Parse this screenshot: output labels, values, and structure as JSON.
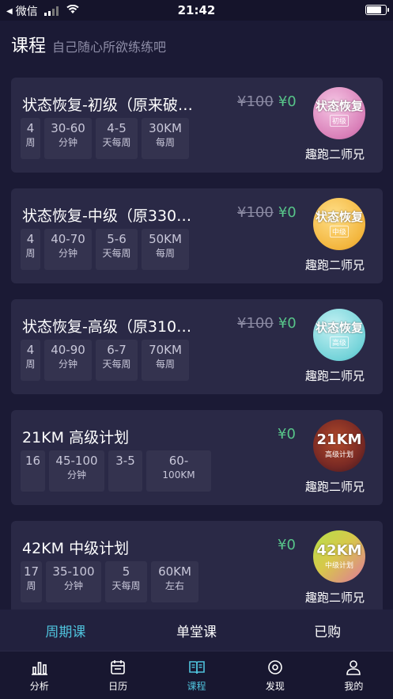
{
  "status_bar": {
    "back_app": "微信",
    "time": "21:42",
    "battery_level": 0.85
  },
  "header": {
    "title": "课程",
    "subtitle": "自己随心所欲练练吧"
  },
  "courses": [
    {
      "title": "状态恢复-初级（原来破…",
      "price_original": "¥100",
      "price_current": "¥0",
      "stats": [
        {
          "value": "4",
          "unit": "周"
        },
        {
          "value": "30-60",
          "unit": "分钟"
        },
        {
          "value": "4-5",
          "unit": "天每周"
        },
        {
          "value": "30KM",
          "unit": "每周"
        }
      ],
      "badge": {
        "main": "状态恢复",
        "sub": "初级",
        "icon": "status-recovery-badge"
      },
      "coach": "趣跑二师兄"
    },
    {
      "title": "状态恢复-中级（原330…",
      "price_original": "¥100",
      "price_current": "¥0",
      "stats": [
        {
          "value": "4",
          "unit": "周"
        },
        {
          "value": "40-70",
          "unit": "分钟"
        },
        {
          "value": "5-6",
          "unit": "天每周"
        },
        {
          "value": "50KM",
          "unit": "每周"
        }
      ],
      "badge": {
        "main": "状态恢复",
        "sub": "中级",
        "icon": "status-recovery-badge"
      },
      "coach": "趣跑二师兄"
    },
    {
      "title": "状态恢复-高级（原310…",
      "price_original": "¥100",
      "price_current": "¥0",
      "stats": [
        {
          "value": "4",
          "unit": "周"
        },
        {
          "value": "40-90",
          "unit": "分钟"
        },
        {
          "value": "6-7",
          "unit": "天每周"
        },
        {
          "value": "70KM",
          "unit": "每周"
        }
      ],
      "badge": {
        "main": "状态恢复",
        "sub": "高级",
        "icon": "status-recovery-badge"
      },
      "coach": "趣跑二师兄"
    },
    {
      "title": "21KM 高级计划",
      "price_original": "",
      "price_current": "¥0",
      "stats": [
        {
          "value": "16",
          "unit": ""
        },
        {
          "value": "45-100",
          "unit": "分钟"
        },
        {
          "value": "3-5",
          "unit": ""
        },
        {
          "value": "60-",
          "unit": "100KM"
        }
      ],
      "badge": {
        "main": "21KM",
        "sub": "高级计划",
        "icon": "21km-plan-badge"
      },
      "coach": "趣跑二师兄"
    },
    {
      "title": "42KM 中级计划",
      "price_original": "",
      "price_current": "¥0",
      "stats": [
        {
          "value": "17",
          "unit": "周"
        },
        {
          "value": "35-100",
          "unit": "分钟"
        },
        {
          "value": "5",
          "unit": "天每周"
        },
        {
          "value": "60KM",
          "unit": "左右"
        }
      ],
      "badge": {
        "main": "42KM",
        "sub": "中级计划",
        "icon": "42km-plan-badge"
      },
      "coach": "趣跑二师兄"
    }
  ],
  "segment_tabs": [
    {
      "label": "周期课",
      "active": true
    },
    {
      "label": "单堂课",
      "active": false
    },
    {
      "label": "已购",
      "active": false
    }
  ],
  "bottom_nav": [
    {
      "label": "分析",
      "icon": "bar-chart-icon"
    },
    {
      "label": "日历",
      "icon": "calendar-icon"
    },
    {
      "label": "课程",
      "icon": "book-icon",
      "active": true
    },
    {
      "label": "发现",
      "icon": "compass-icon"
    },
    {
      "label": "我的",
      "icon": "person-icon"
    }
  ],
  "colors": {
    "accent": "#4fc3dd",
    "price_green": "#57c489",
    "background": "#1b1a35",
    "card": "#2a2946"
  }
}
